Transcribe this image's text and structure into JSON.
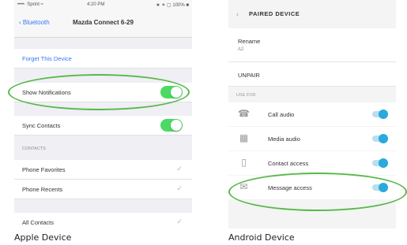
{
  "apple": {
    "status_left": "••••◦ Sprint ≈",
    "status_time": "4:20 PM",
    "status_right": "★ ✶ ▢ 100% ■",
    "back_label": "‹ Bluetooth",
    "title": "Mazda Connect 6-29",
    "forget_label": "Forget This Device",
    "show_notifications_label": "Show Notifications",
    "sync_contacts_label": "Sync Contacts",
    "section_label": "CONTACTS",
    "phone_favorites_label": "Phone Favorites",
    "phone_recents_label": "Phone Recents",
    "all_contacts_label": "All Contacts",
    "caption": "Apple Device"
  },
  "android": {
    "header_title": "PAIRED DEVICE",
    "rename_label": "Rename",
    "rename_value": "A2",
    "unpair_label": "UNPAIR",
    "section_label": "USE FOR",
    "call_audio_label": "Call audio",
    "media_audio_label": "Media audio",
    "contact_access_label": "Contact access",
    "message_access_label": "Message access",
    "caption": "Android Device"
  },
  "colors": {
    "ios_switch_on": "#4cd964",
    "android_toggle_on": "#29a9dc",
    "highlight": "#59b84b",
    "ios_link": "#3478f6"
  }
}
